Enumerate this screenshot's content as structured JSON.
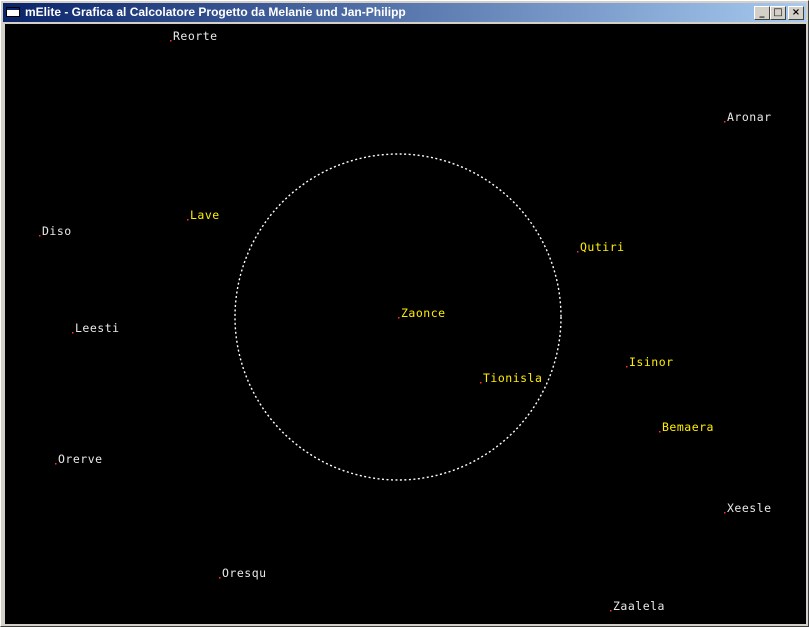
{
  "window": {
    "title": "mElite - Grafica al Calcolatore Progetto da Melanie und Jan-Philipp",
    "icon": "app-window-icon",
    "controls": {
      "minimize": "_",
      "maximize": "□",
      "close": "×"
    }
  },
  "map": {
    "background": "#000000",
    "range_circle": {
      "color": "#ffffff",
      "style": "dotted"
    },
    "colors": {
      "in_range": "#ffee00",
      "out_of_range": "#e8e8e8",
      "marker": "#ff3030"
    },
    "systems": [
      {
        "name": "Reorte",
        "in_range": false
      },
      {
        "name": "Aronar",
        "in_range": false
      },
      {
        "name": "Lave",
        "in_range": true
      },
      {
        "name": "Diso",
        "in_range": false
      },
      {
        "name": "Qutiri",
        "in_range": true
      },
      {
        "name": "Zaonce",
        "in_range": true
      },
      {
        "name": "Leesti",
        "in_range": false
      },
      {
        "name": "Isinor",
        "in_range": true
      },
      {
        "name": "Tionisla",
        "in_range": true
      },
      {
        "name": "Bemaera",
        "in_range": true
      },
      {
        "name": "Orerve",
        "in_range": false
      },
      {
        "name": "Xeesle",
        "in_range": false
      },
      {
        "name": "Oresqu",
        "in_range": false
      },
      {
        "name": "Zaalela",
        "in_range": false
      }
    ]
  }
}
